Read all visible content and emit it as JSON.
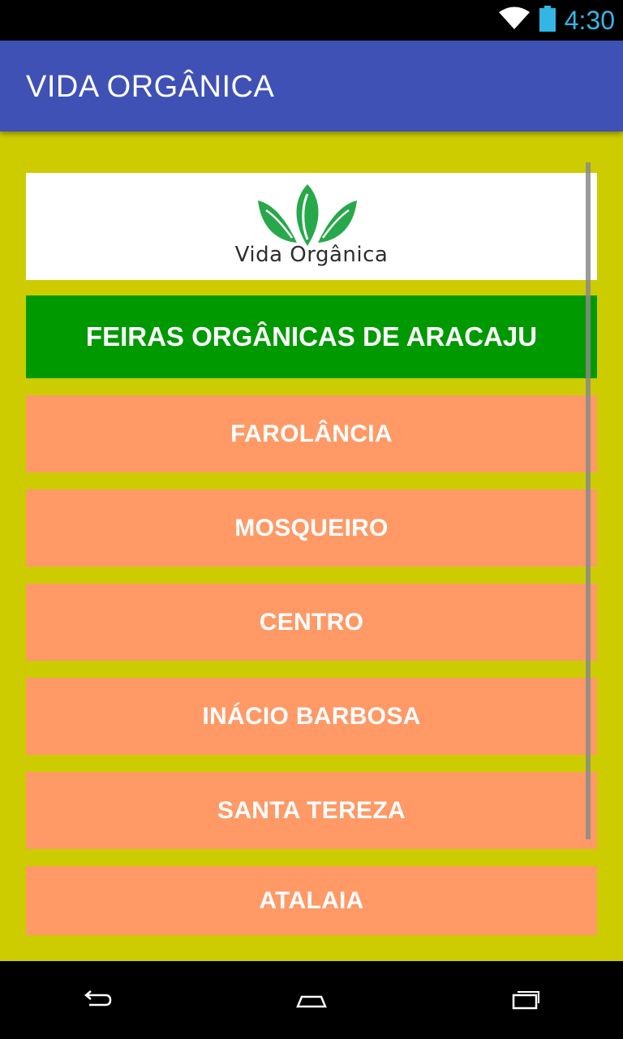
{
  "status_bar": {
    "time": "4:30",
    "icons": [
      "wifi-icon",
      "battery-icon"
    ],
    "clock_color": "#33b5e5"
  },
  "app_bar": {
    "title": "VIDA ORGÂNICA",
    "color": "#3f51b5"
  },
  "content": {
    "background": "#cccc00",
    "logo": {
      "text": "Vida Orgânica",
      "icon": "leaves-logo-icon"
    },
    "header": {
      "text": "FEIRAS ORGÂNICAS DE ARACAJU",
      "color": "#009900"
    },
    "items": [
      {
        "label": "FAROLÂNCIA"
      },
      {
        "label": "MOSQUEIRO"
      },
      {
        "label": "CENTRO"
      },
      {
        "label": "INÁCIO BARBOSA"
      },
      {
        "label": "SANTA TEREZA"
      },
      {
        "label": "ATALAIA"
      }
    ],
    "item_color": "#ff9966"
  },
  "nav_bar": {
    "icons": [
      "back-icon",
      "home-icon",
      "recents-icon"
    ]
  }
}
